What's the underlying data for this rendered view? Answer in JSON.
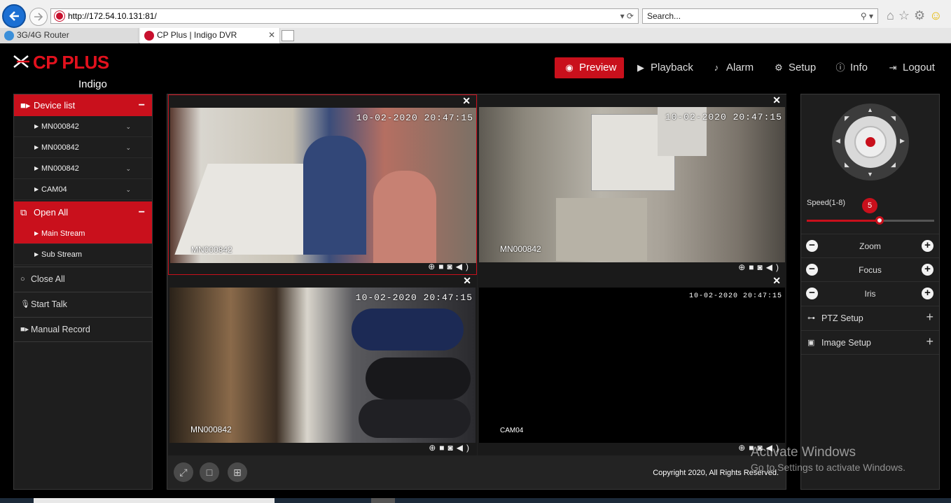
{
  "browser": {
    "url": "http://172.54.10.131:81/",
    "search_placeholder": "Search...",
    "tabs": [
      {
        "label": "3G/4G Router"
      },
      {
        "label": "CP Plus | Indigo DVR"
      }
    ]
  },
  "header": {
    "brand": "CP PLUS",
    "sub": "Indigo",
    "nav": [
      {
        "label": "Preview",
        "icon": "eye-icon"
      },
      {
        "label": "Playback",
        "icon": "play-icon"
      },
      {
        "label": "Alarm",
        "icon": "bell-icon"
      },
      {
        "label": "Setup",
        "icon": "gear-icon"
      },
      {
        "label": "Info",
        "icon": "info-icon"
      },
      {
        "label": "Logout",
        "icon": "logout-icon"
      }
    ]
  },
  "sidebar": {
    "device_list_label": "Device list",
    "devices": [
      {
        "label": "MN000842"
      },
      {
        "label": "MN000842"
      },
      {
        "label": "MN000842"
      },
      {
        "label": "CAM04"
      }
    ],
    "open_all_label": "Open All",
    "streams": [
      {
        "label": "Main Stream"
      },
      {
        "label": "Sub Stream"
      }
    ],
    "close_all_label": "Close All",
    "start_talk_label": "Start Talk",
    "manual_record_label": "Manual Record"
  },
  "cells": [
    {
      "timestamp": "10-02-2020 20:47:15",
      "camera": "MN000842"
    },
    {
      "timestamp": "10-02-2020 20:47:15",
      "camera": "MN000842"
    },
    {
      "timestamp": "10-02-2020 20:47:15",
      "camera": "MN000842"
    },
    {
      "timestamp": "10-02-2020 20:47:15",
      "camera": "CAM04"
    }
  ],
  "footer": {
    "copyright": "Copyright 2020, All Rights Reserved."
  },
  "ptz": {
    "speed_label": "Speed(1-8)",
    "speed_value": "5",
    "speed_min": 1,
    "speed_max": 8,
    "zoom_label": "Zoom",
    "focus_label": "Focus",
    "iris_label": "Iris",
    "ptz_setup_label": "PTZ Setup",
    "image_setup_label": "Image Setup"
  },
  "watermark": {
    "line1": "Activate Windows",
    "line2": "Go to Settings to activate Windows."
  },
  "colors": {
    "accent": "#c9101c",
    "panel": "#1e1e1e"
  }
}
